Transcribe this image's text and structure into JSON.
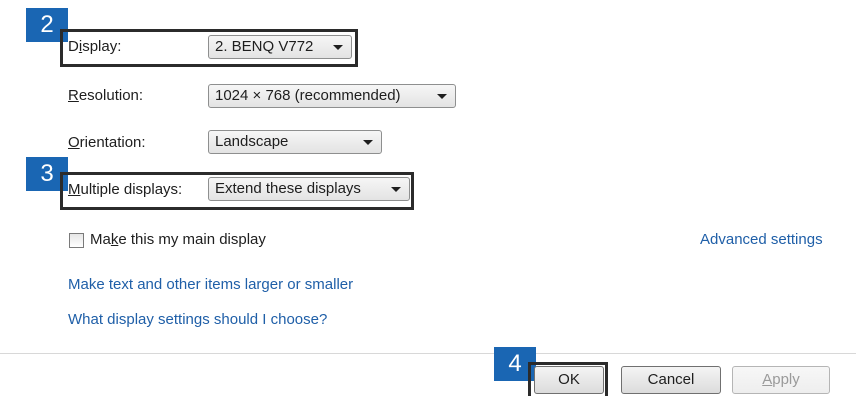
{
  "badges": {
    "step2": "2",
    "step3": "3",
    "step4": "4"
  },
  "fields": {
    "display": {
      "label_first": "D",
      "label_mnemonic": "i",
      "label_rest": "splay:",
      "value": "2. BENQ V772"
    },
    "resolution": {
      "label_mnemonic": "R",
      "label_rest": "esolution:",
      "value": "1024 × 768 (recommended)"
    },
    "orientation": {
      "label_mnemonic": "O",
      "label_rest": "rientation:",
      "value": "Landscape"
    },
    "multiple_displays": {
      "label_mnemonic": "M",
      "label_rest": "ultiple displays:",
      "value": "Extend these displays"
    }
  },
  "main_display": {
    "label_first": "Ma",
    "label_mnemonic": "k",
    "label_rest": "e this my main display",
    "checked": false
  },
  "links": {
    "advanced_settings": "Advanced settings",
    "text_size": "Make text and other items larger or smaller",
    "settings_help": "What display settings should I choose?"
  },
  "buttons": {
    "ok": "OK",
    "cancel": "Cancel",
    "apply_mnemonic": "A",
    "apply_rest": "pply"
  },
  "colors": {
    "badge": "#1a66b3",
    "link": "#1f5fa8",
    "highlight_box": "#2b2b2b"
  }
}
